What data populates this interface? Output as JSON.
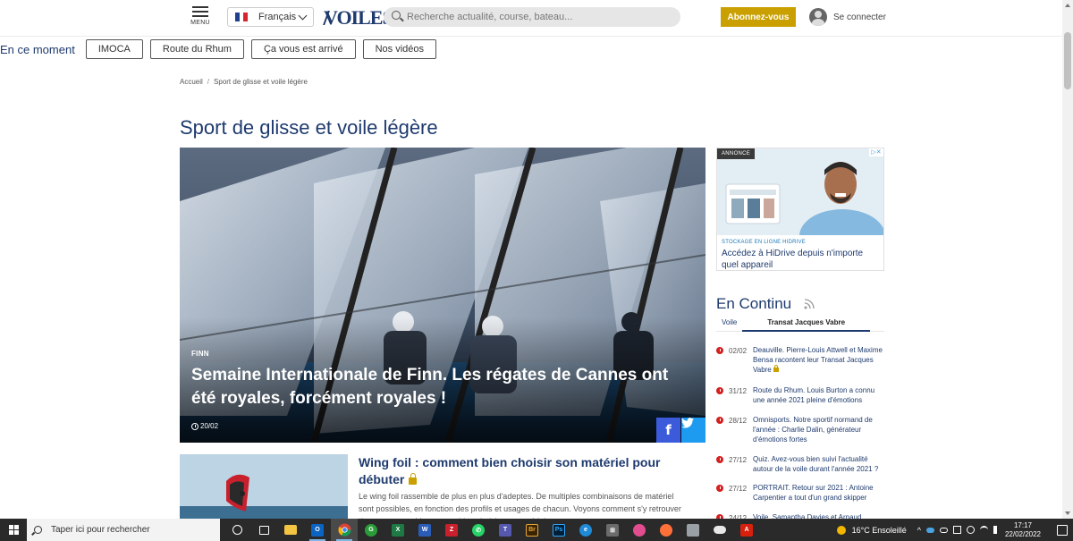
{
  "header": {
    "menu_label": "MENU",
    "language": "Français",
    "logo_text": "VOILES",
    "search_placeholder": "Recherche actualité, course, bateau...",
    "subscribe_label": "Abonnez-vous",
    "login_label": "Se connecter"
  },
  "trending": {
    "label": "En ce moment",
    "items": [
      "IMOCA",
      "Route du Rhum",
      "Ça vous est arrivé",
      "Nos vidéos"
    ]
  },
  "breadcrumb": {
    "home": "Accueil",
    "separator": "/",
    "current": "Sport de glisse et voile légère"
  },
  "page_title": "Sport de glisse et voile légère",
  "hero": {
    "tag": "FINN",
    "headline": "Semaine Internationale de Finn. Les régates de Cannes ont été royales, forcément royales !",
    "date": "20/02",
    "facebook": "f"
  },
  "article2": {
    "title": "Wing foil : comment bien choisir son matériel pour débuter",
    "description": "Le wing foil rassemble de plus en plus d'adeptes. De multiples combinaisons de matériel sont possibles, en fonction des profils et usages de chacun. Voyons comment s'y retrouver dans cet ensemble vaste et bien choisir son matériel."
  },
  "ad": {
    "label": "ANNONCE",
    "sponsor": "STOCKAGE EN LIGNE HIDRIVE",
    "headline": "Accédez à HiDrive depuis n'importe quel appareil"
  },
  "en_continu": {
    "title": "En Continu",
    "tabs": [
      "Voile",
      "Transat Jacques Vabre"
    ],
    "items": [
      {
        "date": "02/02",
        "text": "Deauville. Pierre-Louis Attwell et Maxime Bensa racontent leur Transat Jacques Vabre"
      },
      {
        "date": "31/12",
        "text": "Route du Rhum. Louis Burton a connu une année 2021 pleine d'émotions"
      },
      {
        "date": "28/12",
        "text": "Omnisports. Notre sportif normand de l'année : Charlie Dalin, générateur d'émotions fortes"
      },
      {
        "date": "27/12",
        "text": "Quiz. Avez-vous bien suivi l'actualité autour de la voile durant l'année 2021 ?"
      },
      {
        "date": "27/12",
        "text": "PORTRAIT. Retour sur 2021 : Antoine Carpentier a tout d'un grand skipper"
      },
      {
        "date": "24/12",
        "text": "Voile. Samantha Davies et Arnaud"
      }
    ]
  },
  "taskbar": {
    "search_text": "Taper ici pour rechercher",
    "weather": "16°C  Ensoleillé",
    "time": "17:17",
    "date": "22/02/2022"
  },
  "colors": {
    "brand_navy": "#1e3a6e",
    "subscribe_gold": "#c9a000",
    "news_dot_red": "#d41f1f",
    "facebook_blue": "#3b5bdb",
    "twitter_blue": "#1d9bf0",
    "taskbar_dark": "#2a2a2a"
  }
}
